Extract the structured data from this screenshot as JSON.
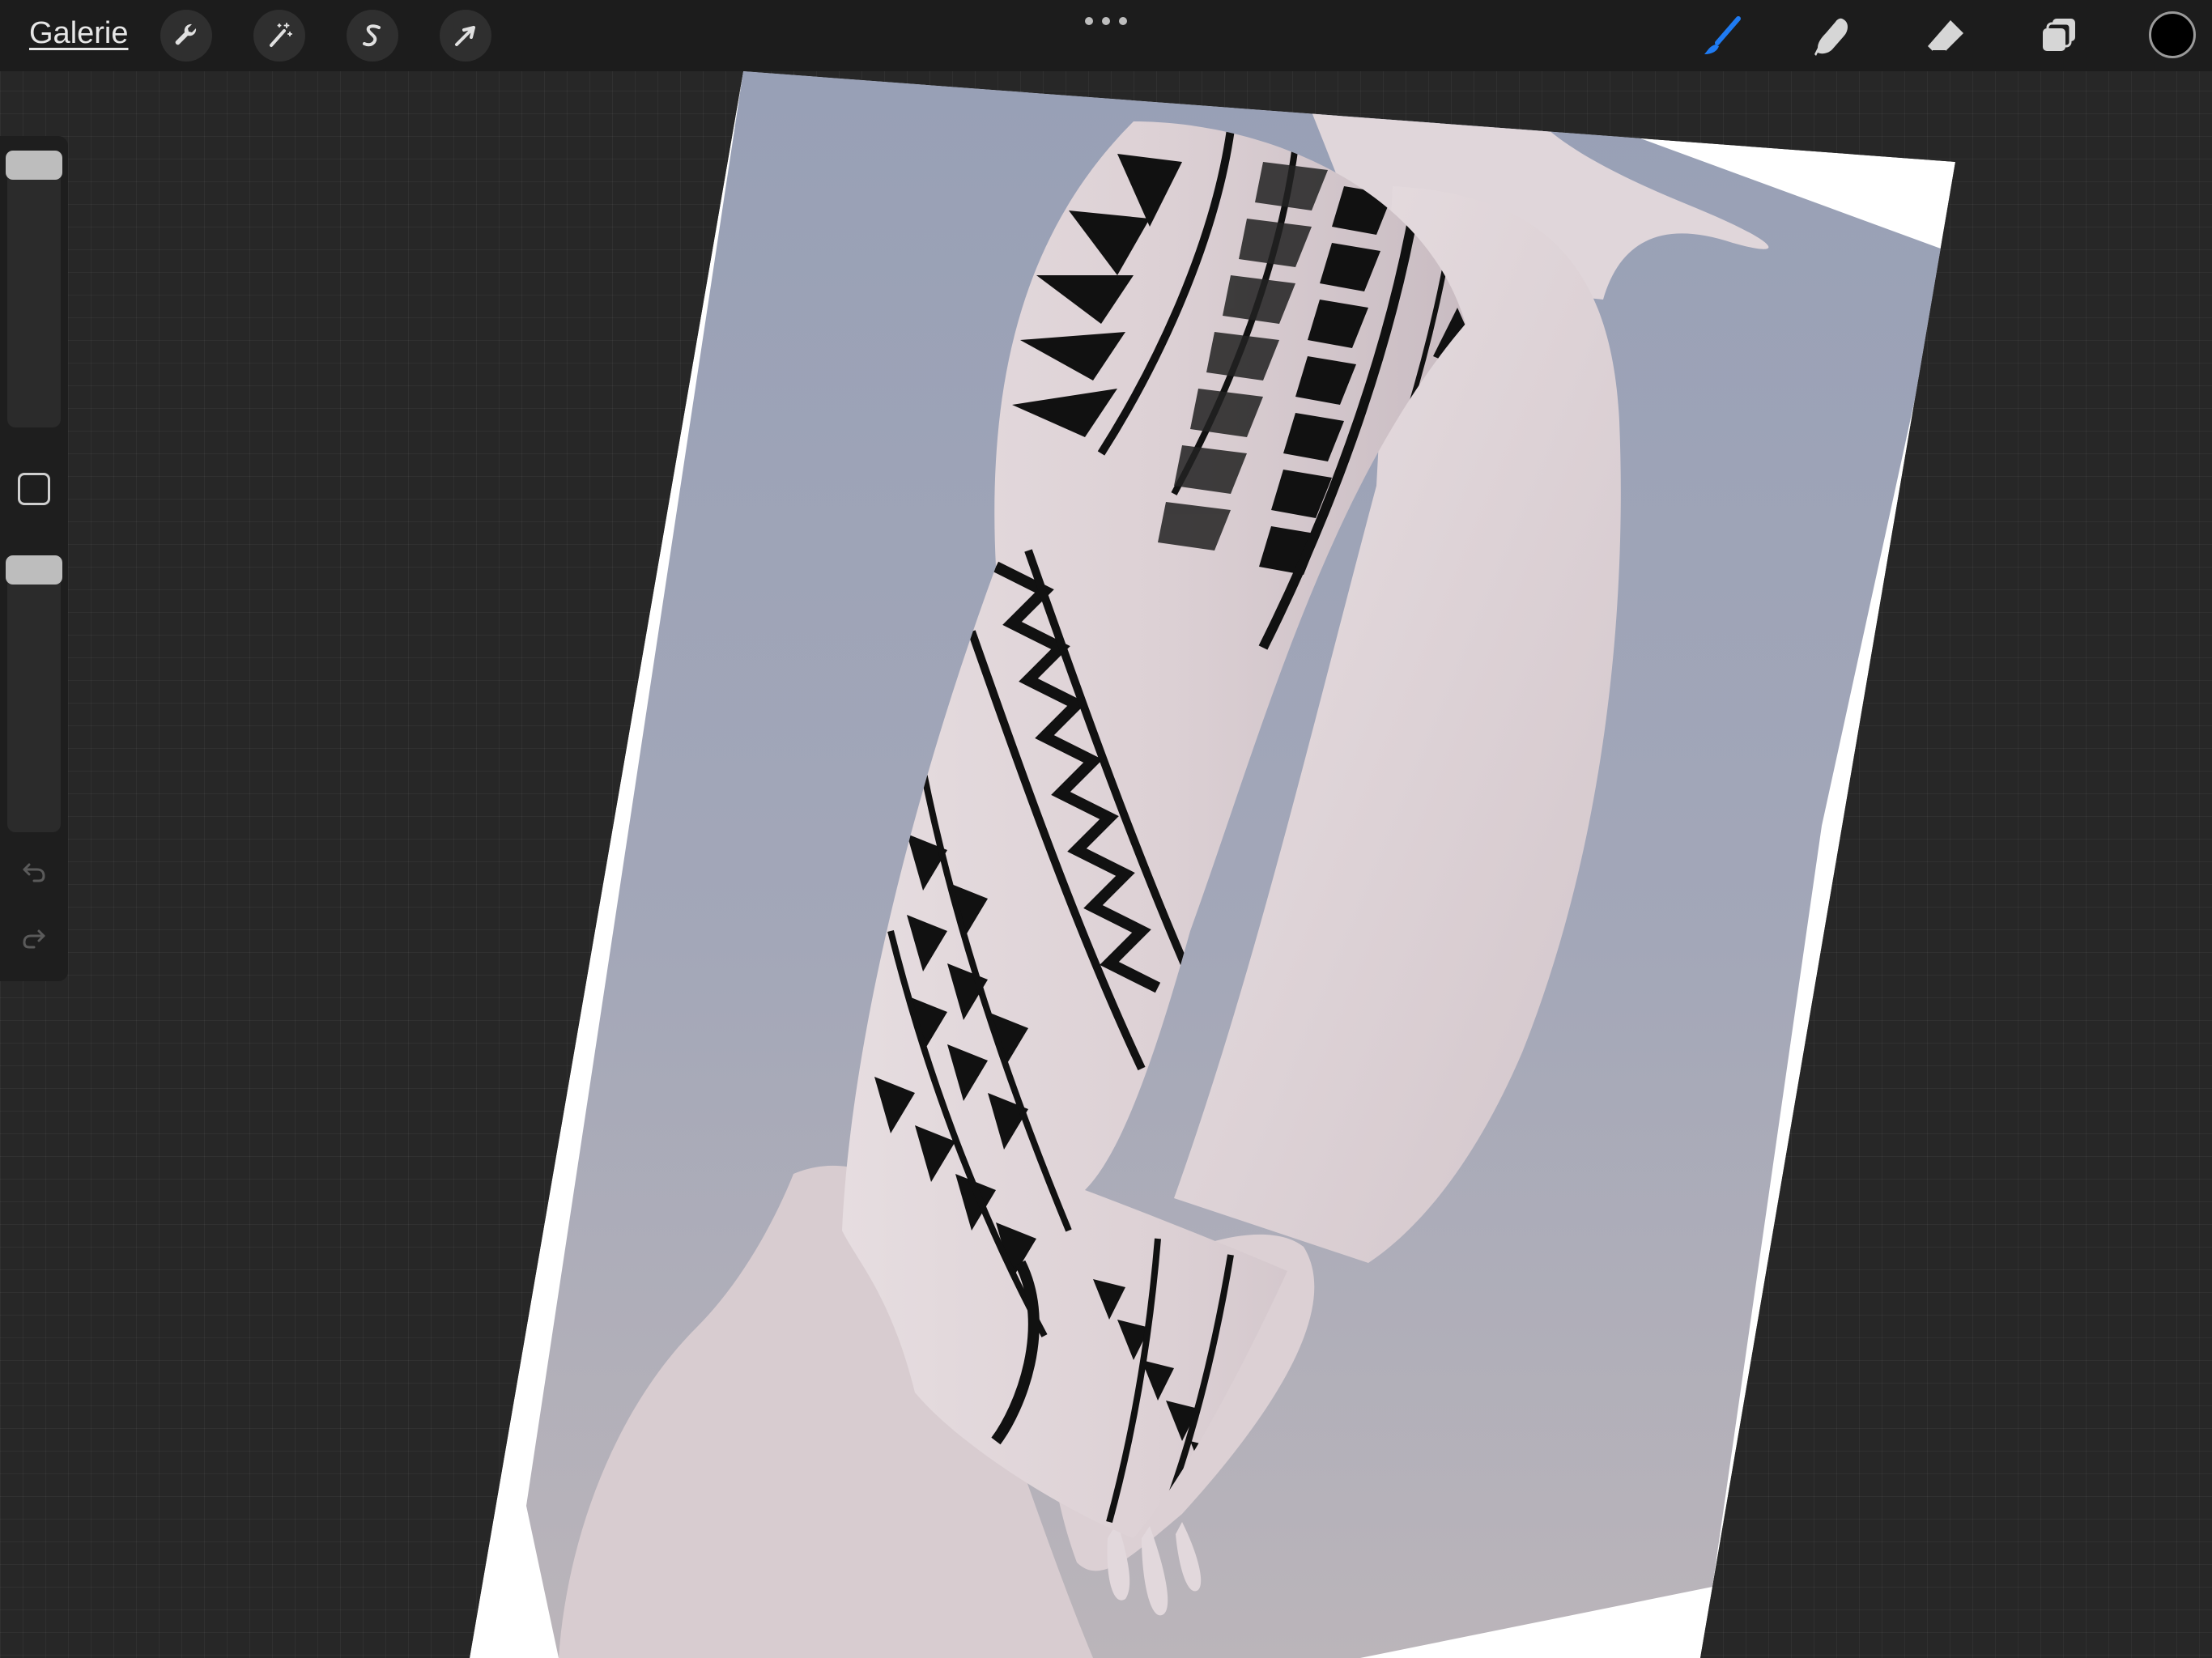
{
  "topbar": {
    "gallery_label": "Galerie",
    "actions_tool": "wrench-icon",
    "adjustments_tool": "magic-wand-icon",
    "selection_tool": "selection-s-icon",
    "transform_tool": "arrow-cursor-icon",
    "more_menu": "ellipsis-icon",
    "brush_tool": "brush-icon",
    "smudge_tool": "smudge-finger-icon",
    "eraser_tool": "eraser-icon",
    "layers_tool": "layers-icon",
    "current_color": "#000000",
    "brush_active_color": "#1f7bf2"
  },
  "sidebar": {
    "brush_size_slider": 0.0,
    "modify_button": "square-modify-icon",
    "opacity_slider": 0.0,
    "undo": "undo-icon",
    "redo": "redo-icon"
  }
}
